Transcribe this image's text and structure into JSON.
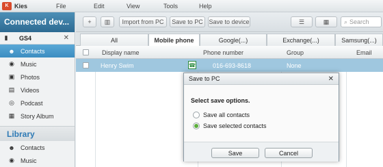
{
  "app": {
    "title": "Kies",
    "logo_text": "K"
  },
  "menu": [
    "File",
    "Edit",
    "View",
    "Tools",
    "Help"
  ],
  "sidebar": {
    "connected_header": "Connected dev...",
    "device": {
      "name": "GS4"
    },
    "items": [
      {
        "label": "Contacts",
        "icon": "person-icon",
        "active": true
      },
      {
        "label": "Music",
        "icon": "music-icon",
        "active": false
      },
      {
        "label": "Photos",
        "icon": "photo-icon",
        "active": false
      },
      {
        "label": "Videos",
        "icon": "film-icon",
        "active": false
      },
      {
        "label": "Podcast",
        "icon": "podcast-icon",
        "active": false
      },
      {
        "label": "Story Album",
        "icon": "album-icon",
        "active": false
      }
    ],
    "library_header": "Library",
    "library_items": [
      {
        "label": "Contacts",
        "icon": "person-icon"
      },
      {
        "label": "Music",
        "icon": "music-icon"
      }
    ]
  },
  "toolbar": {
    "import_label": "Import from PC",
    "save_pc_label": "Save to PC",
    "save_device_label": "Save to device",
    "search_placeholder": "Search"
  },
  "tabs": [
    "All",
    "Mobile phone",
    "Google(...)",
    "Exchange(...)",
    "Samsung(...)"
  ],
  "grid": {
    "headers": {
      "display_name": "Display name",
      "phone_number": "Phone number",
      "group": "Group",
      "email": "Email"
    },
    "rows": [
      {
        "display_name": "Henry Swim",
        "phone_number": "016-693-8618",
        "group": "None",
        "email": ""
      }
    ]
  },
  "dialog": {
    "title": "Save to PC",
    "heading": "Select save options.",
    "options": [
      {
        "label": "Save all contacts",
        "selected": false
      },
      {
        "label": "Save selected contacts",
        "selected": true
      }
    ],
    "save_label": "Save",
    "cancel_label": "Cancel"
  },
  "colors": {
    "accent": "#3c8dc1",
    "selected_row": "#9fc7df",
    "radio_on": "#5cae3c"
  }
}
